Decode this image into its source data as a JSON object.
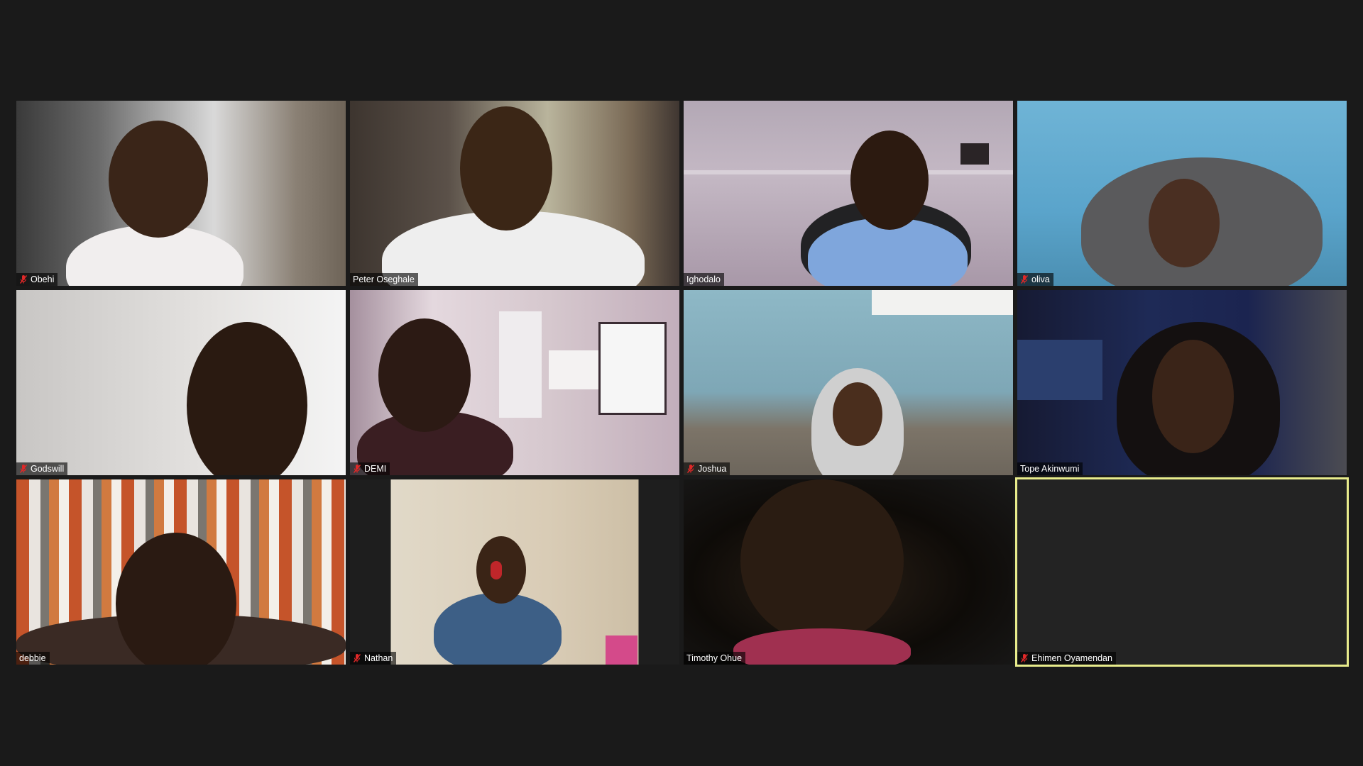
{
  "meeting": {
    "view": "gallery",
    "participants": [
      {
        "name": "Obehi",
        "muted": true
      },
      {
        "name": "Peter Oseghale",
        "muted": false
      },
      {
        "name": "Ighodalo",
        "muted": false
      },
      {
        "name": "oliva",
        "muted": true
      },
      {
        "name": "Godswill",
        "muted": true
      },
      {
        "name": "DEMI",
        "muted": true
      },
      {
        "name": "Joshua",
        "muted": true
      },
      {
        "name": "Tope Akinwumi",
        "muted": false
      },
      {
        "name": "debbie",
        "muted": false
      },
      {
        "name": "Nathan",
        "muted": true
      },
      {
        "name": "Timothy Ohue",
        "muted": false
      },
      {
        "name": "Ehimen Oyamendan",
        "muted": true,
        "active_speaker": true,
        "video_off": true
      }
    ]
  },
  "colors": {
    "background": "#1a1a1a",
    "active_speaker_border": "#e8ec8c",
    "muted_icon": "#e02828"
  },
  "icons": {
    "muted": "muted-microphone-icon"
  }
}
